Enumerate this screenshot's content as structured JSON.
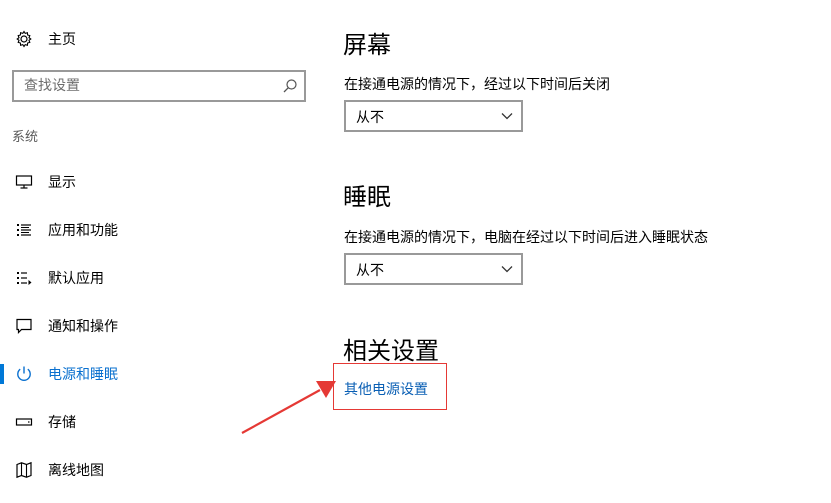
{
  "sidebar": {
    "home_label": "主页",
    "search_placeholder": "查找设置",
    "section_label": "系统",
    "items": [
      {
        "label": "显示",
        "icon": "monitor-icon"
      },
      {
        "label": "应用和功能",
        "icon": "apps-list-icon"
      },
      {
        "label": "默认应用",
        "icon": "default-apps-icon"
      },
      {
        "label": "通知和操作",
        "icon": "notification-icon"
      },
      {
        "label": "电源和睡眠",
        "icon": "power-icon",
        "active": true
      },
      {
        "label": "存储",
        "icon": "storage-icon"
      },
      {
        "label": "离线地图",
        "icon": "map-icon"
      }
    ]
  },
  "screen": {
    "title": "屏幕",
    "desc": "在接通电源的情况下，经过以下时间后关闭",
    "value": "从不"
  },
  "sleep": {
    "title": "睡眠",
    "desc": "在接通电源的情况下，电脑在经过以下时间后进入睡眠状态",
    "value": "从不"
  },
  "related": {
    "title": "相关设置",
    "link": "其他电源设置"
  },
  "colors": {
    "accent": "#0078d7",
    "link": "#0a5fb4",
    "highlight_box": "#e53935",
    "arrow": "#e53935"
  }
}
